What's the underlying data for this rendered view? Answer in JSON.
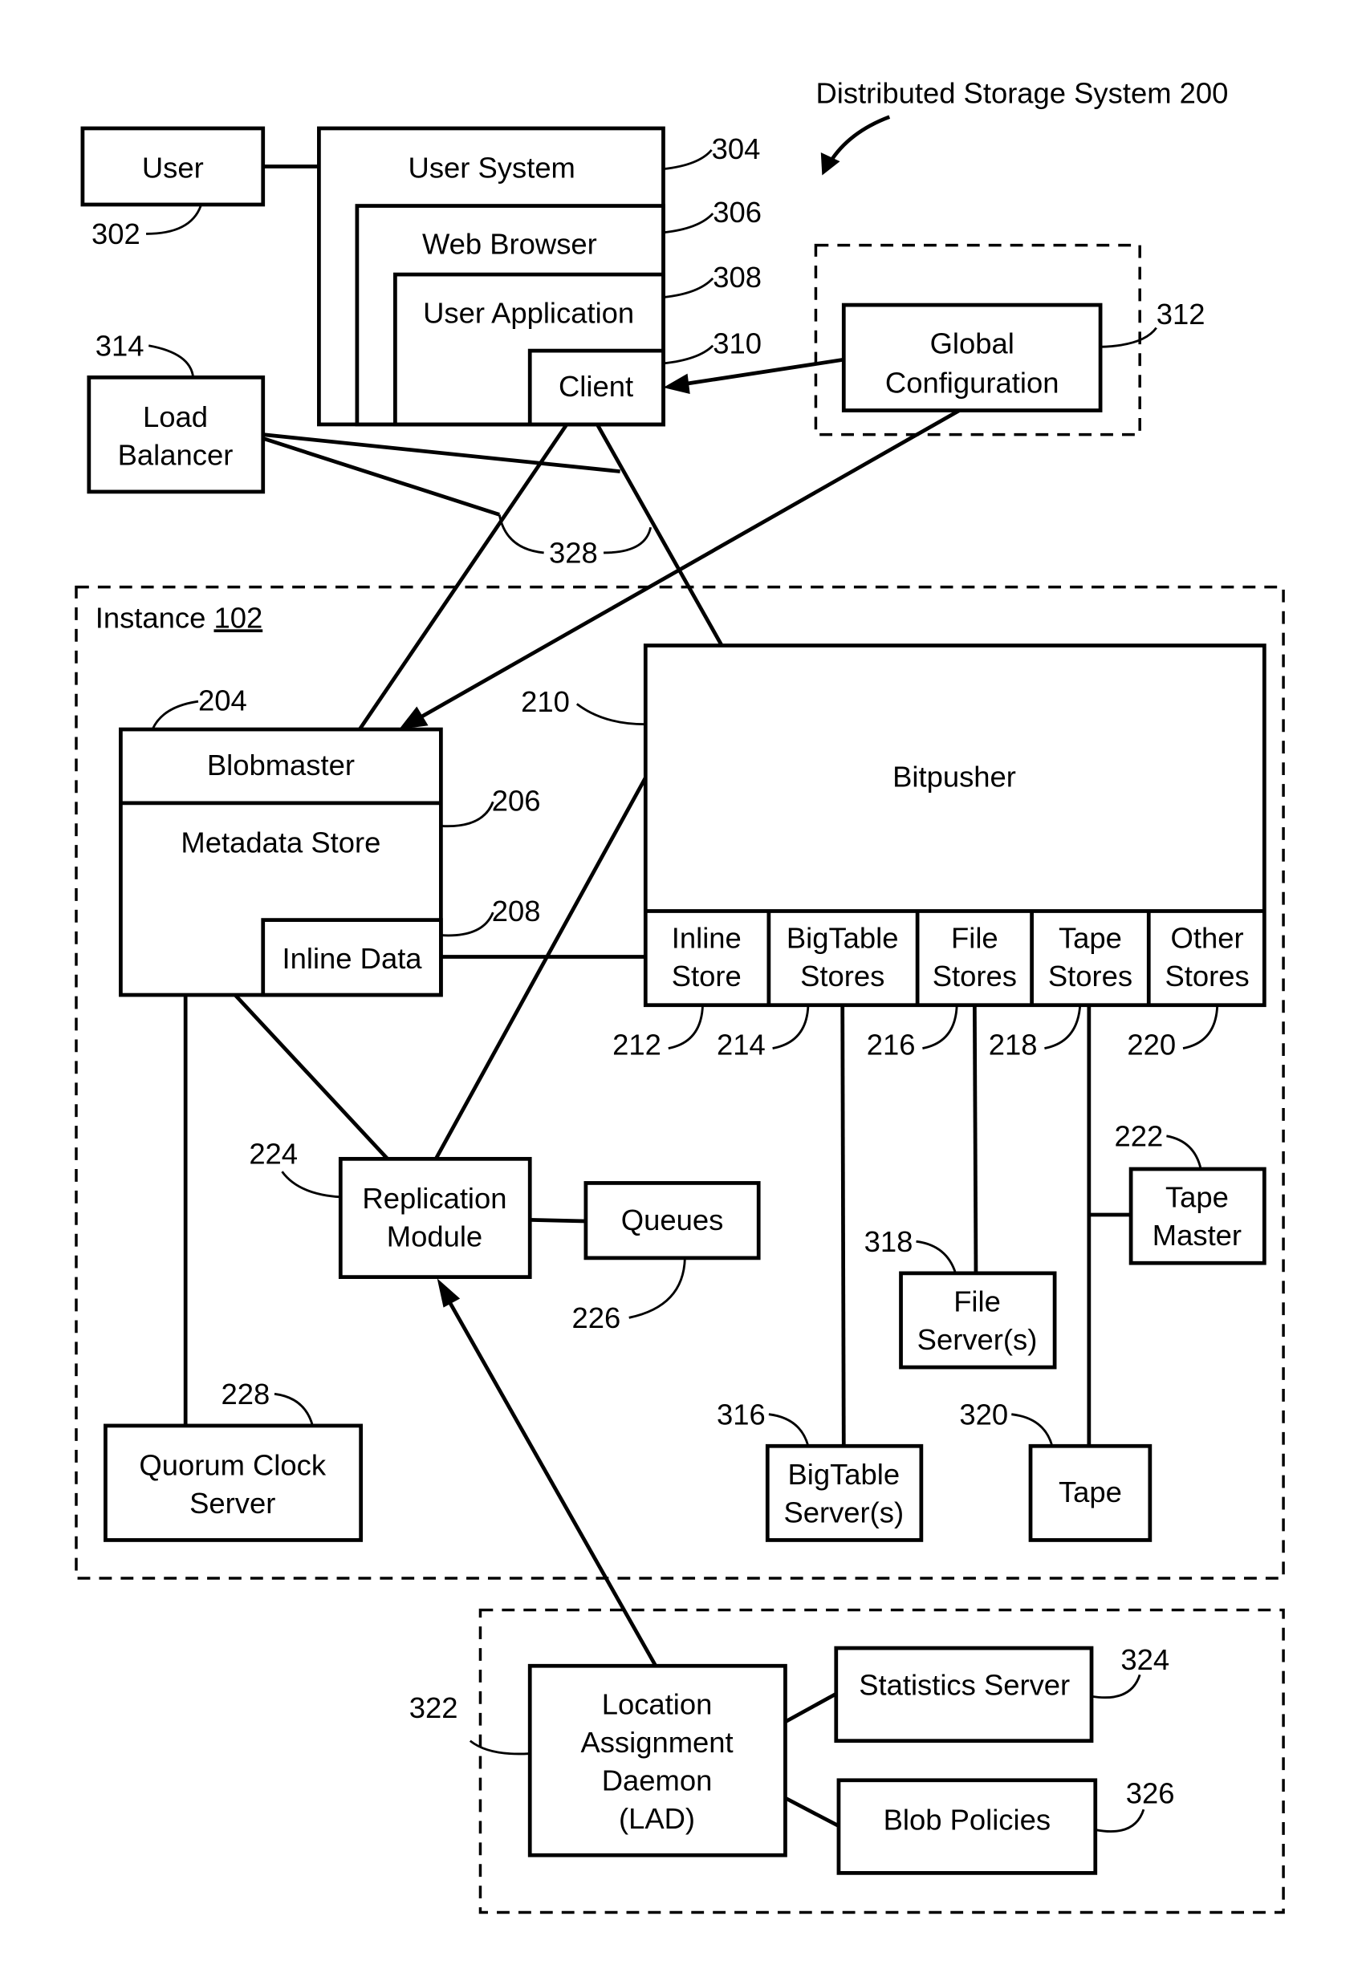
{
  "title": "Distributed Storage System 200",
  "colors": {
    "ink": "#000000",
    "background": "#ffffff"
  },
  "components": {
    "user": {
      "label": "User",
      "ref": "302"
    },
    "user_system": {
      "label": "User System",
      "ref": "304"
    },
    "web_browser": {
      "label": "Web Browser",
      "ref": "306"
    },
    "user_application": {
      "label": "User Application",
      "ref": "308"
    },
    "client": {
      "label": "Client",
      "ref": "310"
    },
    "global_configuration": {
      "line1": "Global",
      "line2": "Configuration",
      "ref": "312"
    },
    "load_balancer": {
      "line1": "Load",
      "line2": "Balancer",
      "ref": "314"
    },
    "network_ref": "328",
    "instance": {
      "label": "Instance",
      "ref": "102"
    },
    "blobmaster": {
      "label": "Blobmaster",
      "ref": "204"
    },
    "metadata_store": {
      "label": "Metadata Store",
      "ref": "206"
    },
    "inline_data": {
      "label": "Inline Data",
      "ref": "208"
    },
    "bitpusher": {
      "label": "Bitpusher",
      "ref": "210"
    },
    "stores": [
      {
        "line1": "Inline",
        "line2": "Store",
        "ref": "212"
      },
      {
        "line1": "BigTable",
        "line2": "Stores",
        "ref": "214"
      },
      {
        "line1": "File",
        "line2": "Stores",
        "ref": "216"
      },
      {
        "line1": "Tape",
        "line2": "Stores",
        "ref": "218"
      },
      {
        "line1": "Other",
        "line2": "Stores",
        "ref": "220"
      }
    ],
    "tape_master": {
      "line1": "Tape",
      "line2": "Master",
      "ref": "222"
    },
    "replication_module": {
      "line1": "Replication",
      "line2": "Module",
      "ref": "224"
    },
    "queues": {
      "label": "Queues",
      "ref": "226"
    },
    "quorum_clock_server": {
      "line1": "Quorum Clock",
      "line2": "Server",
      "ref": "228"
    },
    "bigtable_servers": {
      "line1": "BigTable",
      "line2": "Server(s)",
      "ref": "316"
    },
    "file_servers": {
      "line1": "File",
      "line2": "Server(s)",
      "ref": "318"
    },
    "tape": {
      "label": "Tape",
      "ref": "320"
    },
    "lad": {
      "line1": "Location",
      "line2": "Assignment",
      "line3": "Daemon",
      "line4": "(LAD)",
      "ref": "322"
    },
    "statistics_server": {
      "label": "Statistics Server",
      "ref": "324"
    },
    "blob_policies": {
      "label": "Blob Policies",
      "ref": "326"
    }
  }
}
